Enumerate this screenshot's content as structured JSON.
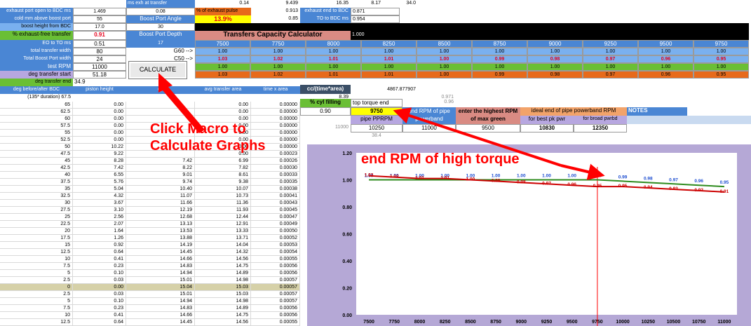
{
  "header_rows": {
    "r0": {
      "ms_exh_label": "ms exh at transfer",
      "v1": "0.14",
      "v2": "9.439",
      "v3": "16.35",
      "v4": "8.17",
      "v5": "34.0"
    },
    "r1": {
      "label": "exhaust port open to BDC ms",
      "value": "1.469",
      "val2": "0.08",
      "pct_label": "% of exhaust pulse",
      "pct_val": "0.913",
      "exh_end_label": "exhaust end to BDC",
      "exh_end_val": "0.871"
    },
    "r2": {
      "label": "cold mm above boost port",
      "value": "55",
      "bpa_label": "Boost Port Angle",
      "bpa_val": "13.9%",
      "v": "0.85",
      "to_bdc_label": "TO to BDC ms",
      "to_bdc_val": "0.954"
    },
    "r3": {
      "label": "boost height from BDC",
      "value": "17.0",
      "val2": "30"
    },
    "r4": {
      "label": "% exhaust-free transfer",
      "value": "0.91",
      "bpd_label": "Boost Port Depth",
      "calc_title": "Transfers Capacity Calculator",
      "v": "1.000"
    },
    "r5": {
      "label": "EO to TO ms",
      "value": "0.51",
      "val2": "17"
    },
    "r6": {
      "label": "total transfer width",
      "value": "80",
      "g60": "G60 -->"
    },
    "r7": {
      "label": "Total Boost Port width",
      "value": "24",
      "c50": "C50 -->"
    },
    "r8": {
      "label": "test RPM",
      "value": "11000"
    },
    "r9": {
      "label": "deg transfer start",
      "value": "51.18"
    },
    "r10": {
      "label": "deg transfer end",
      "value": "34.9"
    }
  },
  "rpm_header": [
    "7500",
    "7750",
    "8000",
    "8250",
    "8500",
    "8750",
    "9000",
    "9250",
    "9500",
    "9750"
  ],
  "row_g60": [
    "1.00",
    "1.00",
    "1.00",
    "1.00",
    "1.00",
    "1.00",
    "1.00",
    "1.00",
    "1.00",
    "1.00"
  ],
  "row_c50": [
    "1.03",
    "1.02",
    "1.01",
    "1.01",
    "1.00",
    "0.99",
    "0.98",
    "0.97",
    "0.96",
    "0.95"
  ],
  "row_test": [
    "1.00",
    "1.00",
    "1.00",
    "1.00",
    "1.00",
    "1.00",
    "1.00",
    "1.00",
    "1.00",
    "1.00"
  ],
  "row_start": [
    "1.03",
    "1.02",
    "1.01",
    "1.01",
    "1.00",
    "0.99",
    "0.98",
    "0.97",
    "0.96",
    "0.95"
  ],
  "calculate_button": "CALCULATE",
  "table_header": {
    "deg": "deg before/after BDC",
    "piston": "piston height",
    "op": "op",
    "avg": "avg transfer area",
    "time": "time x area",
    "cc": "cc/(time*area)"
  },
  "sub_header": {
    "label": "(135* duration) 67.5",
    "v": "8.39"
  },
  "right_panel": {
    "cyl_label": "% cyl filling",
    "cyl_val": "0.90",
    "ttq_label": "top torque end",
    "ttq_val": "9750",
    "end_rpm_label": "end RPM of pipe powerband",
    "pipe_label": "pipe PPRPM",
    "pipe_val": "10250",
    "pb_val": "11000",
    "enter_label": "enter the highest RPM of max green",
    "enter_val": "9500",
    "ideal_label": "ideal end of pipe powerband RPM",
    "best_label": "for best pk pwr",
    "best_val": "10830",
    "broad_label": "for broad pwrbd",
    "broad_val": "12350",
    "notes_label": "NOTES",
    "misc1": "4867.877907",
    "misc2": "0.96",
    "misc3": "0.971",
    "misc4": "11000",
    "misc5": "38.4"
  },
  "data_rows": [
    {
      "deg": "65",
      "piston": "0.00",
      "op": "",
      "avg": "0.00",
      "time": "0.00000"
    },
    {
      "deg": "62.5",
      "piston": "0.00",
      "op": "",
      "avg": "0.00",
      "time": "0.00000"
    },
    {
      "deg": "60",
      "piston": "0.00",
      "op": "",
      "avg": "0.00",
      "time": "0.00000"
    },
    {
      "deg": "57.5",
      "piston": "0.00",
      "op": "",
      "avg": "0.00",
      "time": "0.00000"
    },
    {
      "deg": "55",
      "piston": "0.00",
      "op": "",
      "avg": "0.00",
      "time": "0.00000"
    },
    {
      "deg": "52.5",
      "piston": "0.00",
      "op": "",
      "avg": "0.00",
      "time": "0.00000"
    },
    {
      "deg": "50",
      "piston": "10.22",
      "op": "",
      "avg": "0.00",
      "time": "0.00000"
    },
    {
      "deg": "47.5",
      "piston": "9.22",
      "op": "",
      "avg": "0.00",
      "time": "0.00023"
    },
    {
      "deg": "45",
      "piston": "8.28",
      "op": "7.42",
      "avg": "6.99",
      "time": "0.00026"
    },
    {
      "deg": "42.5",
      "piston": "7.42",
      "op": "8.22",
      "avg": "7.82",
      "time": "0.00030"
    },
    {
      "deg": "40",
      "piston": "6.55",
      "op": "9.01",
      "avg": "8.61",
      "time": "0.00033"
    },
    {
      "deg": "37.5",
      "piston": "5.76",
      "op": "9.74",
      "avg": "9.38",
      "time": "0.00035"
    },
    {
      "deg": "35",
      "piston": "5.04",
      "op": "10.40",
      "avg": "10.07",
      "time": "0.00038"
    },
    {
      "deg": "32.5",
      "piston": "4.32",
      "op": "11.07",
      "avg": "10.73",
      "time": "0.00041"
    },
    {
      "deg": "30",
      "piston": "3.67",
      "op": "11.66",
      "avg": "11.36",
      "time": "0.00043"
    },
    {
      "deg": "27.5",
      "piston": "3.10",
      "op": "12.19",
      "avg": "11.93",
      "time": "0.00045"
    },
    {
      "deg": "25",
      "piston": "2.56",
      "op": "12.68",
      "avg": "12.44",
      "time": "0.00047"
    },
    {
      "deg": "22.5",
      "piston": "2.07",
      "op": "13.13",
      "avg": "12.91",
      "time": "0.00049"
    },
    {
      "deg": "20",
      "piston": "1.64",
      "op": "13.53",
      "avg": "13.33",
      "time": "0.00050"
    },
    {
      "deg": "17.5",
      "piston": "1.26",
      "op": "13.88",
      "avg": "13.71",
      "time": "0.00052"
    },
    {
      "deg": "15",
      "piston": "0.92",
      "op": "14.19",
      "avg": "14.04",
      "time": "0.00053"
    },
    {
      "deg": "12.5",
      "piston": "0.64",
      "op": "14.45",
      "avg": "14.32",
      "time": "0.00054"
    },
    {
      "deg": "10",
      "piston": "0.41",
      "op": "14.66",
      "avg": "14.56",
      "time": "0.00055"
    },
    {
      "deg": "7.5",
      "piston": "0.23",
      "op": "14.83",
      "avg": "14.75",
      "time": "0.00056"
    },
    {
      "deg": "5",
      "piston": "0.10",
      "op": "14.94",
      "avg": "14.89",
      "time": "0.00056"
    },
    {
      "deg": "2.5",
      "piston": "0.03",
      "op": "15.01",
      "avg": "14.98",
      "time": "0.00057"
    },
    {
      "deg": "0",
      "piston": "0.00",
      "op": "15.04",
      "avg": "15.03",
      "time": "0.00057"
    },
    {
      "deg": "2.5",
      "piston": "0.03",
      "op": "15.01",
      "avg": "15.03",
      "time": "0.00057"
    },
    {
      "deg": "5",
      "piston": "0.10",
      "op": "14.94",
      "avg": "14.98",
      "time": "0.00057"
    },
    {
      "deg": "7.5",
      "piston": "0.23",
      "op": "14.83",
      "avg": "14.89",
      "time": "0.00056"
    },
    {
      "deg": "10",
      "piston": "0.41",
      "op": "14.66",
      "avg": "14.75",
      "time": "0.00056"
    },
    {
      "deg": "12.5",
      "piston": "0.64",
      "op": "14.45",
      "avg": "14.56",
      "time": "0.00055"
    }
  ],
  "annotations": {
    "macro": "Click Macro to Calculate Graphs",
    "torque": "end RPM of high torque"
  },
  "colors": {
    "arrow": "#ff0000",
    "green_series": "#2e8b1e",
    "red_series": "#cc0000",
    "blue_labels": "#1f4fd1"
  },
  "chart_data": {
    "type": "line",
    "categories": [
      "7500",
      "7750",
      "8000",
      "8250",
      "8500",
      "8750",
      "9000",
      "9250",
      "9500",
      "9750",
      "10000",
      "10250",
      "10500",
      "10750",
      "11000"
    ],
    "series": [
      {
        "values": [
          1.0,
          1.0,
          1.0,
          1.0,
          1.0,
          1.0,
          1.0,
          1.0,
          1.0,
          1.0,
          0.99,
          0.98,
          0.97,
          0.96,
          0.95
        ]
      },
      {
        "values": [
          1.03,
          1.02,
          1.01,
          1.01,
          1.0,
          0.99,
          0.98,
          0.97,
          0.96,
          0.95,
          0.95,
          0.94,
          0.93,
          0.92,
          0.91
        ]
      }
    ],
    "ylim": [
      0,
      1.2
    ],
    "yticks": [
      "0.00",
      "0.20",
      "0.40",
      "0.60",
      "0.80",
      "1.00",
      "1.20"
    ],
    "marker_rpm": 9750,
    "grid": false
  }
}
